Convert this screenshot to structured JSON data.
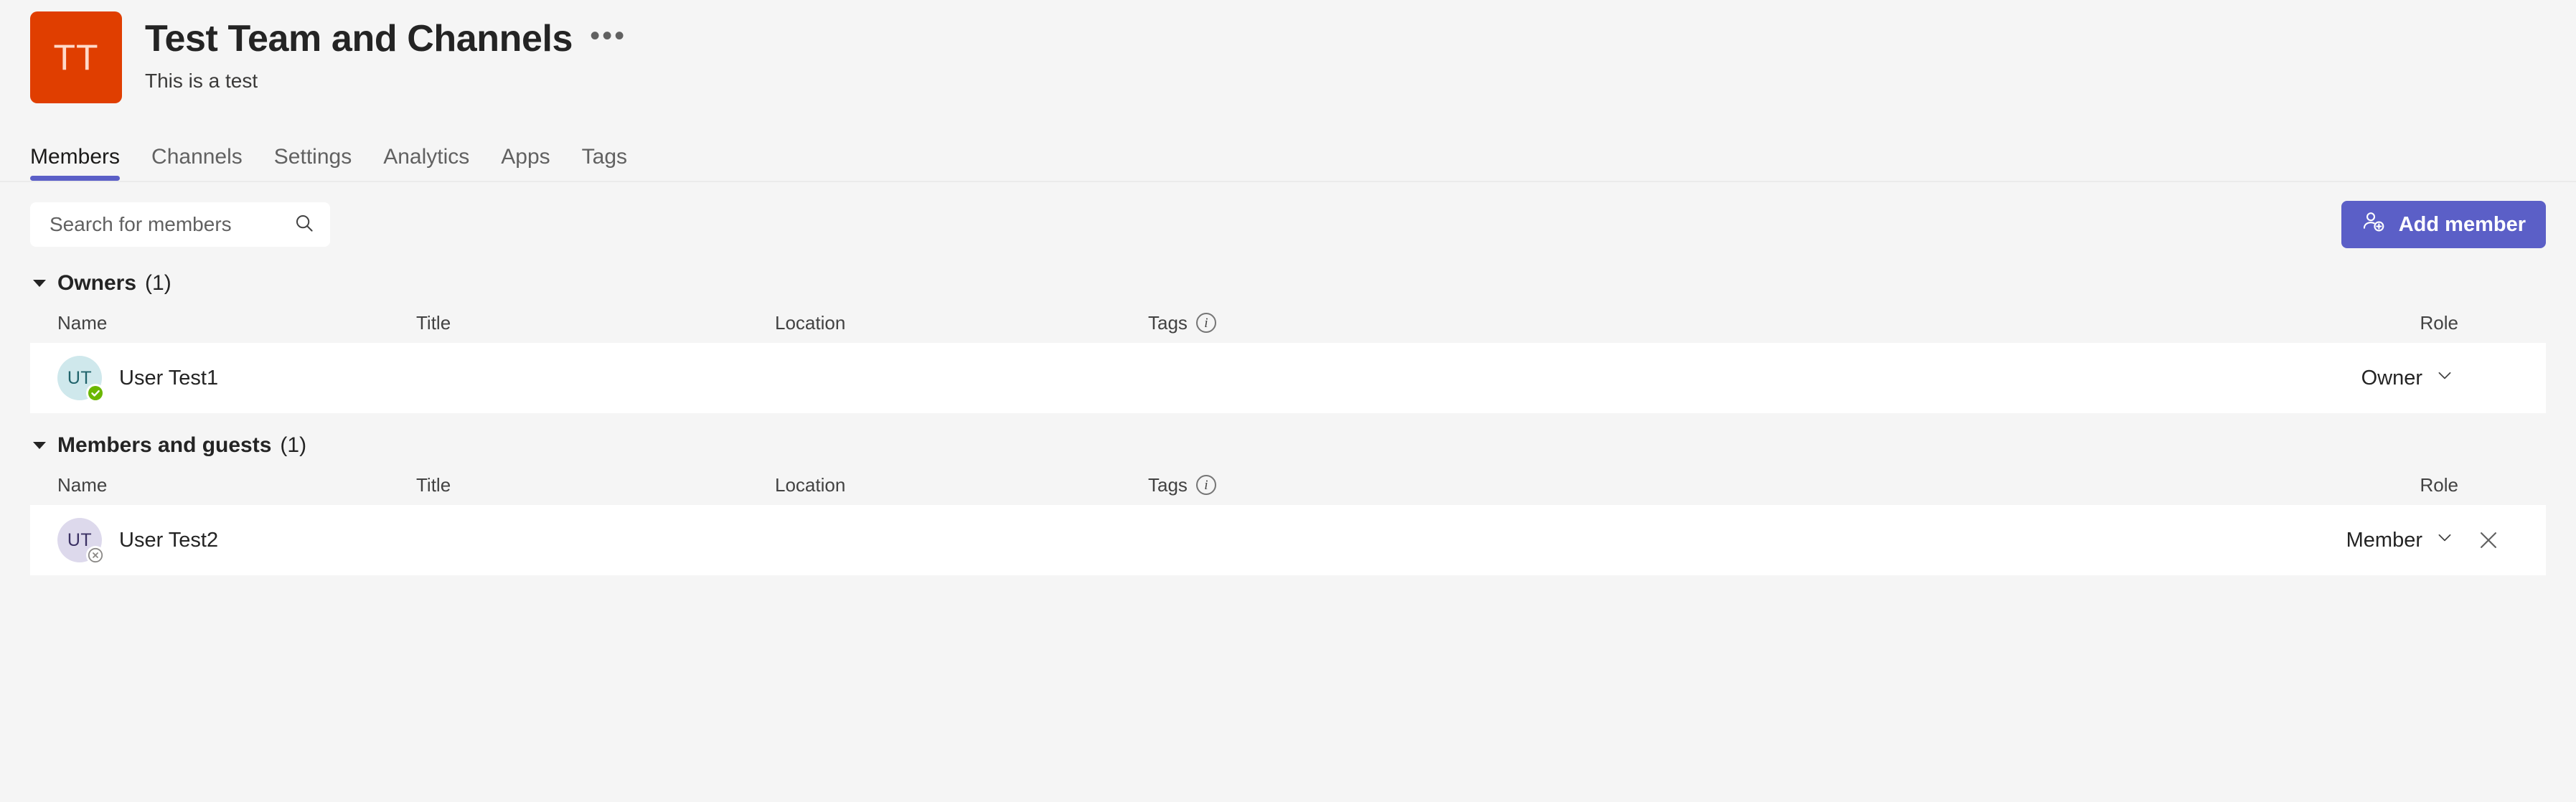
{
  "header": {
    "logo_initials": "TT",
    "logo_color": "#e03e00",
    "title": "Test Team and Channels",
    "more_options": "•••",
    "subtitle": "This is a test"
  },
  "tabs": {
    "active": "Members",
    "accent_color": "#5b5fc7",
    "items": [
      {
        "label": "Members"
      },
      {
        "label": "Channels"
      },
      {
        "label": "Settings"
      },
      {
        "label": "Analytics"
      },
      {
        "label": "Apps"
      },
      {
        "label": "Tags"
      }
    ]
  },
  "toolbar": {
    "search_placeholder": "Search for members",
    "search_value": "",
    "search_icon": "search-icon",
    "add_member_label": "Add member",
    "add_member_icon": "person-add-icon",
    "add_member_color": "#5b5fc7"
  },
  "columns": {
    "name": "Name",
    "title": "Title",
    "location": "Location",
    "tags": "Tags",
    "tags_info_icon": "info-icon",
    "role": "Role"
  },
  "sections": [
    {
      "title": "Owners",
      "count": "(1)",
      "expanded": true,
      "members": [
        {
          "initials": "UT",
          "avatar_color": "#cfe8ec",
          "avatar_text_color": "#20636b",
          "name": "User Test1",
          "title": "",
          "location": "",
          "tags": "",
          "role": "Owner",
          "presence": "available",
          "presence_color": "#6bb700",
          "removable": false
        }
      ]
    },
    {
      "title": "Members and guests",
      "count": "(1)",
      "expanded": true,
      "members": [
        {
          "initials": "UT",
          "avatar_color": "#ddd9ec",
          "avatar_text_color": "#3b3164",
          "name": "User Test2",
          "title": "",
          "location": "",
          "tags": "",
          "role": "Member",
          "presence": "offline",
          "presence_color": "#8a8886",
          "removable": true
        }
      ]
    }
  ]
}
